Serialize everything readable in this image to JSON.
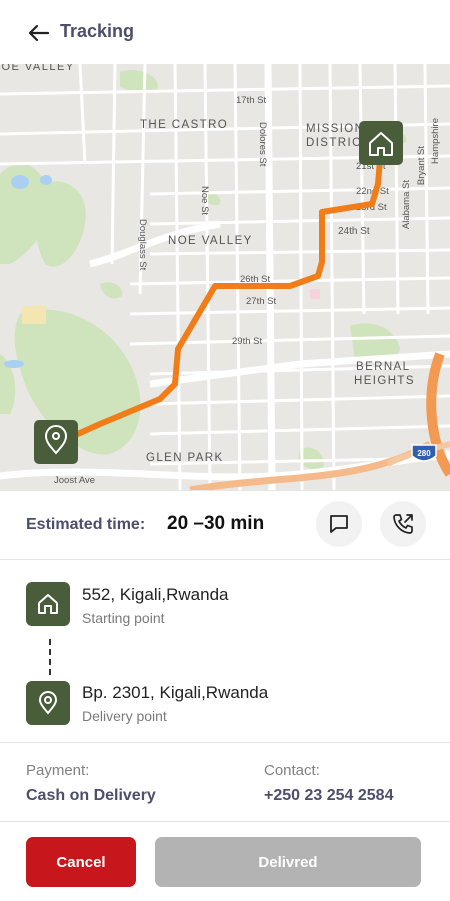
{
  "header": {
    "title": "Tracking",
    "back_icon": "arrow-left-icon"
  },
  "map": {
    "labels": {
      "noe_valley_top": "NOE VALLEY",
      "st17": "17th St",
      "castro": "THE CASTRO",
      "mission": "MISSION",
      "district": "DISTRIC",
      "dolores": "Dolores St",
      "hampshire": "Hampshire",
      "bryant": "Bryant St",
      "alabama": "Alabama St",
      "st21": "21st St",
      "st22": "22nd St",
      "st23": "23rd St",
      "noe_st": "Noe St",
      "douglass": "Douglass St",
      "noe_valley": "NOE VALLEY",
      "st24": "24th St",
      "st26": "26th St",
      "st27": "27th St",
      "st29": "29th St",
      "bernal": "BERNAL",
      "heights": "HEIGHTS",
      "glen_park": "GLEN PARK",
      "joost": "Joost Ave",
      "shield": "280"
    },
    "route_color": "#f07d17",
    "marker_color": "#4a5d3a"
  },
  "eta": {
    "label": "Estimated time:",
    "value": "20 –30 min"
  },
  "actions": {
    "chat_icon": "chat-bubble-icon",
    "call_icon": "phone-outgoing-icon"
  },
  "stops": {
    "origin": {
      "address": "552, Kigali,Rwanda",
      "type": "Starting point",
      "icon": "home-icon"
    },
    "destination": {
      "address": "Bp. 2301, Kigali,Rwanda",
      "type": "Delivery point",
      "icon": "location-pin-icon"
    }
  },
  "payment": {
    "label": "Payment:",
    "value": "Cash on Delivery"
  },
  "contact": {
    "label": "Contact:",
    "value": "+250 23 254 2584"
  },
  "buttons": {
    "cancel": "Cancel",
    "delivered": "Delivred"
  },
  "colors": {
    "primary_green": "#4a5d3a",
    "cancel_red": "#c8161d",
    "disabled_gray": "#b3b3b3",
    "text_slate": "#4b4f6b"
  }
}
